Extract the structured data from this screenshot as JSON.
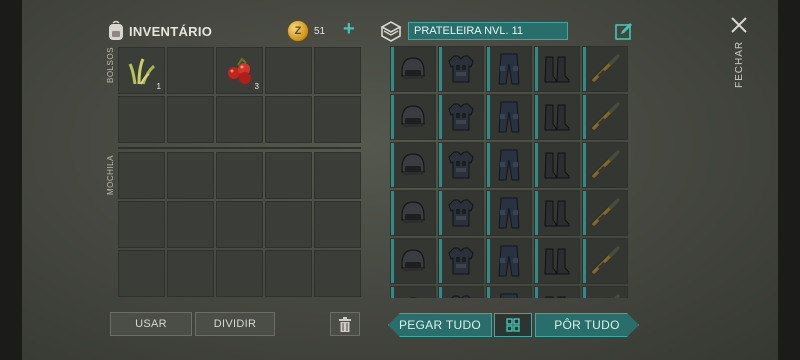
{
  "inventory": {
    "title": "INVENTÁRIO",
    "coins": "51",
    "pockets_label": "BOLSOS",
    "backpack_label": "MOCHILA",
    "pockets": [
      {
        "item": "grass-icon",
        "qty": "1"
      },
      {
        "item": "",
        "qty": ""
      },
      {
        "item": "berries-icon",
        "qty": "3"
      },
      {
        "item": "",
        "qty": ""
      },
      {
        "item": "",
        "qty": ""
      }
    ],
    "use_label": "USAR",
    "split_label": "DIVIDIR"
  },
  "shelf": {
    "title": "PRATELEIRA NVL. 11",
    "columns": [
      "helmet-icon",
      "body-armor-icon",
      "pants-icon",
      "boots-icon",
      "rifle-icon"
    ],
    "take_all_label": "PEGAR TUDO",
    "put_all_label": "PÔR TUDO"
  },
  "close_label": "FECHAR",
  "colors": {
    "accent": "#2a6e6c",
    "accent_border": "#3fa8a0",
    "cell": "#3b3d38"
  }
}
